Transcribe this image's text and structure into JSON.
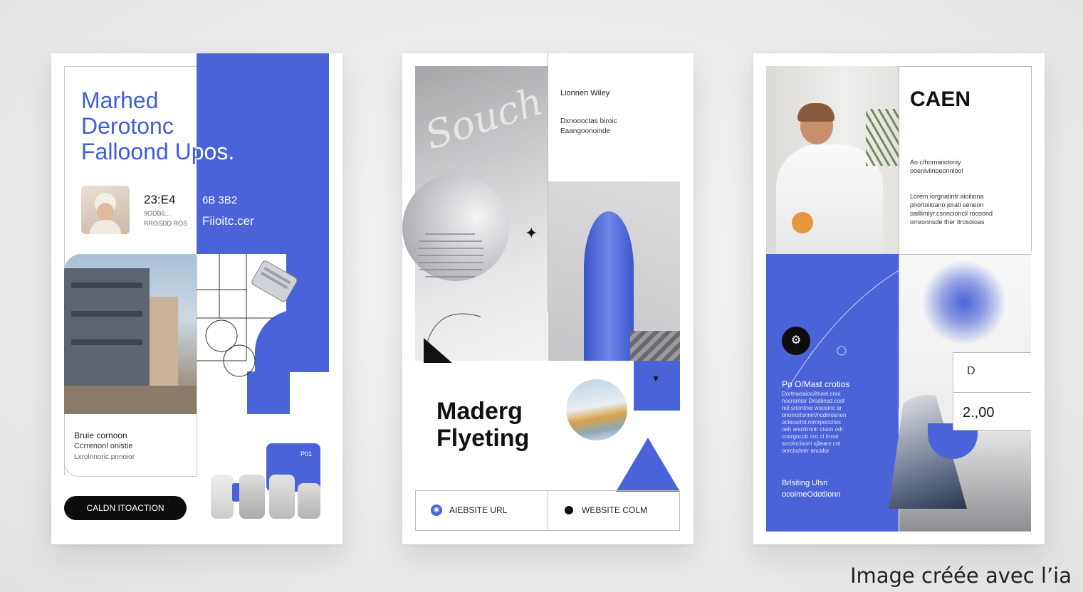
{
  "poster1": {
    "title_lines": [
      "Marhed",
      "Derotonc",
      "Falloond Upos."
    ],
    "stat_left_value": "23:E4",
    "stat_left_sub1": "9ODB6...",
    "stat_left_sub2": "RROSDD ROS",
    "stat_right_value": "6B 3B2",
    "stat_right_label": "Fiioitc.cer",
    "body_lines": [
      "Bruie cornoon",
      "Ccrrenonl onistie",
      "Lxrolnnoric.pnnoior"
    ],
    "cta_label": "CALDN ITOACTION",
    "tag_label": "P01"
  },
  "poster2": {
    "script_word": "Souch",
    "header_line": "Lionnen Wiley",
    "sub_lines": [
      "Dxnoooctas biroic",
      "Eaangoonoinde"
    ],
    "title_lines": [
      "Maderg",
      "Flyeting"
    ],
    "footer_left": "AIEBSITE URL",
    "footer_right": "WEBSITE COLM"
  },
  "poster3": {
    "title": "CAEN",
    "subtitle_lines": [
      "Ao c/hornaisdoniy",
      "ooeniviinoeonniool"
    ],
    "body_lines": [
      "Lorem iorgnatintr aioiliona",
      "pnortoiioano joratl seneon",
      "oaillimlyr.csnncioncil rocoond",
      "orreonnsde ther itrosoioas"
    ],
    "panel_heading": "Po O/Mast crotios",
    "panel_lines": [
      "Dortnwsaioc/itneel.cnoi",
      "nocrsrnisr Drodiinsd.cost",
      "nol sriontrxe woosinc ar",
      "onorrorlonnirl/ncdinosnen",
      "ocieosrlrd.mrnrpoccnox",
      "oeh arsnitronir ciuon odr",
      "conrgncolr nro ct tnnor",
      "scrolociooni sjiieanr.cnt",
      "oorciodetrr ancidor"
    ],
    "panel_footer": [
      "Brlsiting Ulsri",
      "ocoimeOdotlionn"
    ],
    "box_letter": "D",
    "box_value": "2.,00"
  },
  "caption": "Image créée avec l’ia",
  "colors": {
    "accent": "#4a63d8",
    "ink": "#111111",
    "orange": "#e8953d"
  }
}
